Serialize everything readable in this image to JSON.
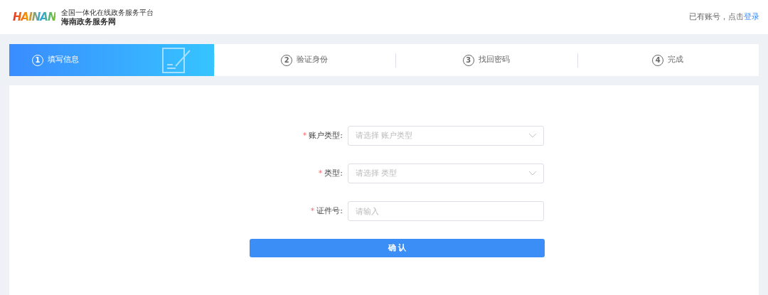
{
  "header": {
    "logo_text": "HAINAN",
    "subtitle": "全国一体化在线政务服务平台",
    "title": "海南政务服务网",
    "login_prompt": "已有账号，点击",
    "login_link": "登录"
  },
  "steps": [
    {
      "number": "1",
      "label": "填写信息",
      "selected": true
    },
    {
      "number": "2",
      "label": "验证身份",
      "selected": false
    },
    {
      "number": "3",
      "label": "找回密码",
      "selected": false
    },
    {
      "number": "4",
      "label": "完成",
      "selected": false
    }
  ],
  "form": {
    "fields": [
      {
        "kind": "select",
        "label": "账户类型:",
        "required": true,
        "placeholder": "请选择 账户类型"
      },
      {
        "kind": "select",
        "label": "类型:",
        "required": true,
        "placeholder": "请选择 类型"
      },
      {
        "kind": "input",
        "label": "证件号:",
        "required": true,
        "placeholder": "请输入"
      }
    ],
    "required_mark": "*",
    "submit": "确 认"
  }
}
